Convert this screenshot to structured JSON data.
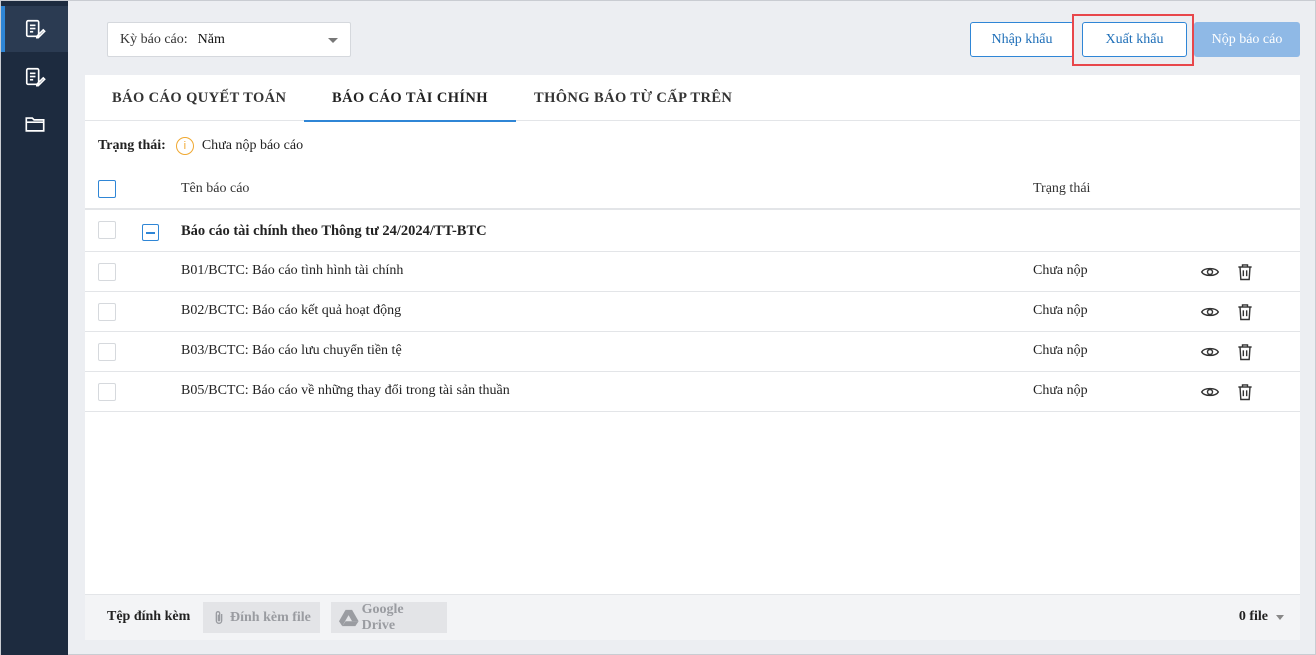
{
  "sidebar": {
    "items": [
      {
        "icon": "report-edit-icon",
        "active": true
      },
      {
        "icon": "report-list-icon",
        "active": false
      },
      {
        "icon": "folder-icon",
        "active": false
      }
    ]
  },
  "toolbar": {
    "period_label": "Kỳ báo cáo:",
    "period_value": "Năm",
    "import_label": "Nhập khẩu",
    "export_label": "Xuất khẩu",
    "submit_label": "Nộp báo cáo"
  },
  "tabs": [
    {
      "label": "BÁO CÁO QUYẾT TOÁN",
      "active": false
    },
    {
      "label": "BÁO CÁO TÀI CHÍNH",
      "active": true
    },
    {
      "label": "THÔNG BÁO TỪ CẤP TRÊN",
      "active": false
    }
  ],
  "status": {
    "label": "Trạng thái:",
    "icon": "info-icon",
    "value": "Chưa nộp báo cáo"
  },
  "table": {
    "columns": {
      "name": "Tên báo cáo",
      "status": "Trạng thái"
    },
    "group": {
      "title": "Báo cáo tài chính theo Thông tư 24/2024/TT-BTC"
    },
    "rows": [
      {
        "name": "B01/BCTC: Báo cáo tình hình tài chính",
        "status": "Chưa nộp"
      },
      {
        "name": "B02/BCTC: Báo cáo kết quả hoạt động",
        "status": "Chưa nộp"
      },
      {
        "name": "B03/BCTC: Báo cáo lưu chuyển tiền tệ",
        "status": "Chưa nộp"
      },
      {
        "name": "B05/BCTC: Báo cáo về những thay đổi trong tài sản thuần",
        "status": "Chưa nộp"
      }
    ]
  },
  "footer": {
    "attachments_label": "Tệp đính kèm",
    "attach_label": "Đính kèm file",
    "drive_label": "Google Drive",
    "file_count": "0 file"
  },
  "colors": {
    "accent": "#2f86d6",
    "sidebar": "#1d2b3f",
    "highlight": "#e8474b",
    "warning": "#f0a830"
  }
}
